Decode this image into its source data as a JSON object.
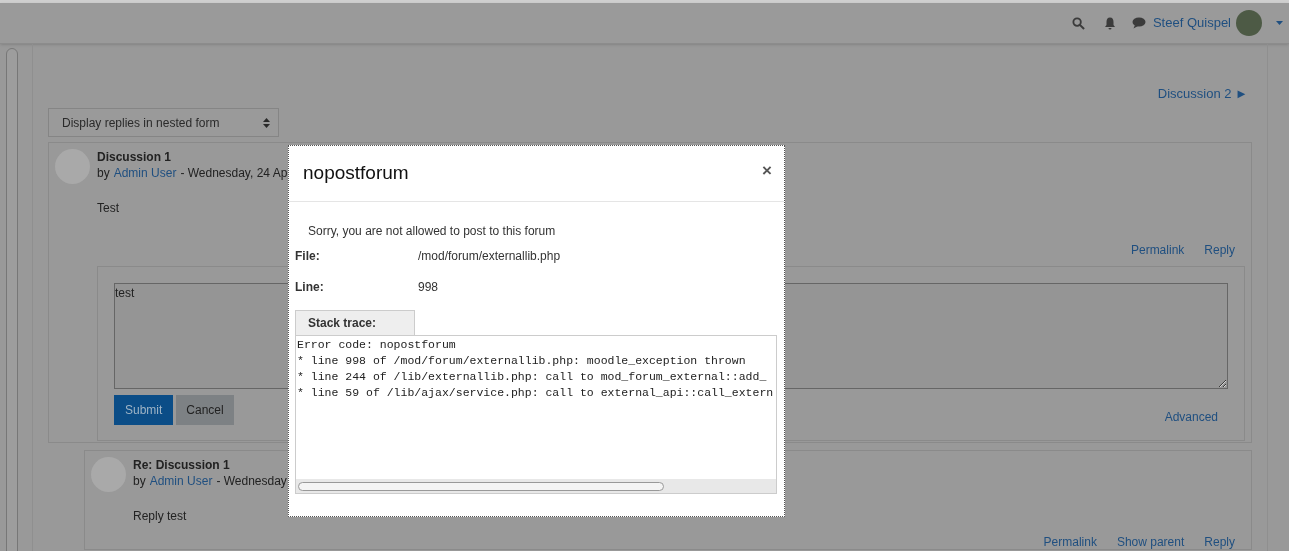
{
  "navbar": {
    "user_name": "Steef Quispel"
  },
  "navigation": {
    "next_link": "Discussion 2 ►"
  },
  "display_mode": {
    "value": "Display replies in nested form"
  },
  "posts": [
    {
      "title": "Discussion 1",
      "by": "by",
      "author": "Admin User",
      "date": "- Wednesday, 24 Ap",
      "body": "Test",
      "links": [
        "Permalink",
        "Reply"
      ],
      "reply_form": {
        "value": "test",
        "buttons": [
          "Submit",
          "Cancel"
        ],
        "advanced_link": "Advanced"
      }
    },
    {
      "title": "Re: Discussion 1",
      "by": "by",
      "author": "Admin User",
      "date": "- Wednesday",
      "body": "Reply test",
      "links": [
        "Permalink",
        "Show parent",
        "Reply"
      ]
    }
  ],
  "dialog": {
    "title": "nopostforum",
    "close": "×",
    "message": "Sorry, you are not allowed to post to this forum",
    "fields": [
      {
        "label": "File:",
        "value": "/mod/forum/externallib.php"
      },
      {
        "label": "Line:",
        "value": "998"
      }
    ],
    "stack_trace_tab": "Stack trace:",
    "stack_trace": [
      "Error code: nopostforum",
      "* line 998 of /mod/forum/externallib.php: moodle_exception thrown",
      "* line 244 of /lib/externallib.php: call to mod_forum_external::add_",
      "* line 59 of /lib/ajax/service.php: call to external_api::call_extern"
    ]
  }
}
